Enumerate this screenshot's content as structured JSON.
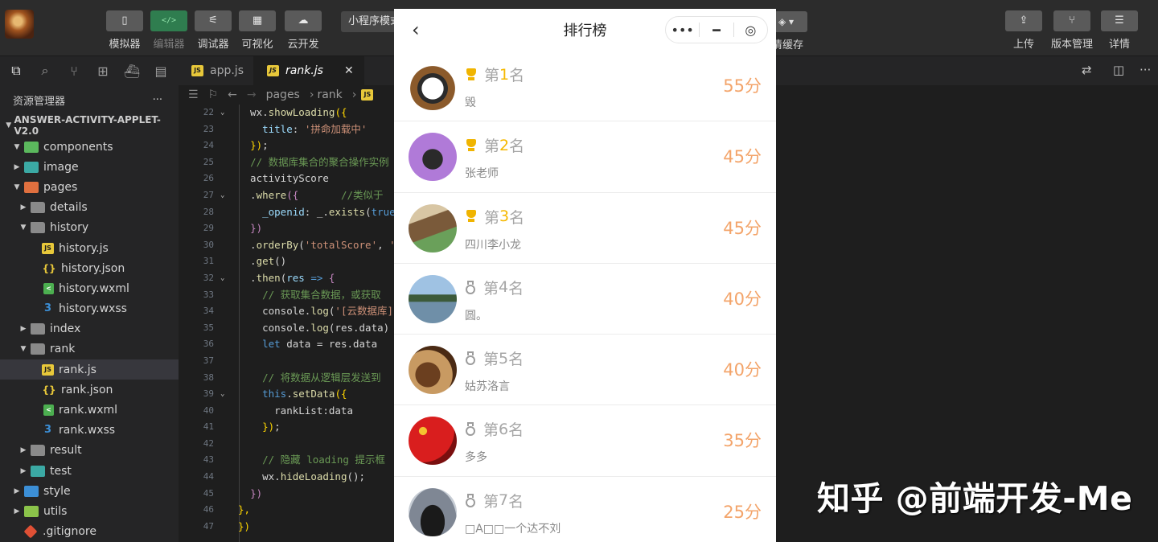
{
  "toolbar": {
    "simulator": "模拟器",
    "editor": "编辑器",
    "debugger": "调试器",
    "visual": "可视化",
    "cloud": "云开发",
    "compile_mode": "小程序模式",
    "clear_cache": "清缓存",
    "upload": "上传",
    "version": "版本管理",
    "details": "详情"
  },
  "explorer": {
    "title": "资源管理器",
    "more": "···",
    "project": "ANSWER-ACTIVITY-APPLET-V2.0",
    "items": [
      {
        "name": "components"
      },
      {
        "name": "image"
      },
      {
        "name": "pages"
      },
      {
        "name": "details"
      },
      {
        "name": "history"
      },
      {
        "name": "history.js"
      },
      {
        "name": "history.json"
      },
      {
        "name": "history.wxml"
      },
      {
        "name": "history.wxss"
      },
      {
        "name": "index"
      },
      {
        "name": "rank"
      },
      {
        "name": "rank.js"
      },
      {
        "name": "rank.json"
      },
      {
        "name": "rank.wxml"
      },
      {
        "name": "rank.wxss"
      },
      {
        "name": "result"
      },
      {
        "name": "test"
      },
      {
        "name": "style"
      },
      {
        "name": "utils"
      },
      {
        "name": ".gitignore"
      }
    ]
  },
  "editor": {
    "tabs": [
      {
        "label": "app.js"
      },
      {
        "label": "rank.js"
      }
    ],
    "breadcrumb": [
      "pages",
      "rank"
    ],
    "line_numbers": [
      "22",
      "23",
      "24",
      "25",
      "26",
      "27",
      "28",
      "29",
      "30",
      "31",
      "32",
      "33",
      "34",
      "35",
      "36",
      "37",
      "38",
      "39",
      "40",
      "41",
      "42",
      "43",
      "44",
      "45",
      "46",
      "47"
    ]
  },
  "phone": {
    "title": "排行榜",
    "rank_prefix": "第",
    "rank_suffix": "名",
    "ranking": [
      {
        "rank": "1",
        "name": "毁",
        "score": "55分"
      },
      {
        "rank": "2",
        "name": "张老师",
        "score": "45分"
      },
      {
        "rank": "3",
        "name": "四川李小龙",
        "score": "45分"
      },
      {
        "rank": "4",
        "name": "圆。",
        "score": "40分"
      },
      {
        "rank": "5",
        "name": "姑苏洛言",
        "score": "40分"
      },
      {
        "rank": "6",
        "name": "多多",
        "score": "35分"
      },
      {
        "rank": "7",
        "name": "□A□□一个达不刘",
        "score": "25分"
      }
    ]
  },
  "watermark": "知乎 @前端开发-Me"
}
